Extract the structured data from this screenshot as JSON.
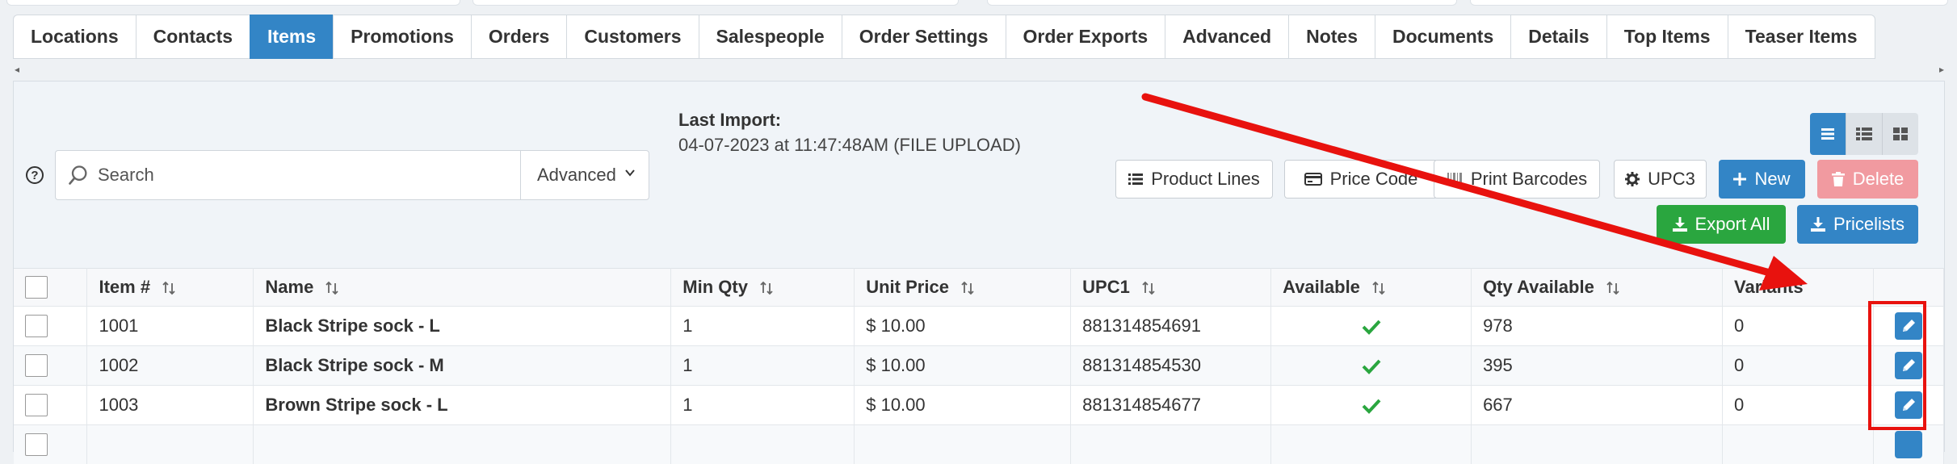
{
  "tabs": [
    {
      "label": "Locations",
      "active": false
    },
    {
      "label": "Contacts",
      "active": false
    },
    {
      "label": "Items",
      "active": true
    },
    {
      "label": "Promotions",
      "active": false
    },
    {
      "label": "Orders",
      "active": false
    },
    {
      "label": "Customers",
      "active": false
    },
    {
      "label": "Salespeople",
      "active": false
    },
    {
      "label": "Order Settings",
      "active": false
    },
    {
      "label": "Order Exports",
      "active": false
    },
    {
      "label": "Advanced",
      "active": false
    },
    {
      "label": "Notes",
      "active": false
    },
    {
      "label": "Documents",
      "active": false
    },
    {
      "label": "Details",
      "active": false
    },
    {
      "label": "Top Items",
      "active": false
    },
    {
      "label": "Teaser Items",
      "active": false
    }
  ],
  "help": {
    "icon": "question-circle-icon",
    "glyph": "?"
  },
  "search": {
    "placeholder": "Search",
    "value": "",
    "icon": "search-icon"
  },
  "advanced_select": {
    "selected": "Advanced"
  },
  "last_import": {
    "label": "Last Import:",
    "value": "04-07-2023 at 11:47:48AM (FILE UPLOAD)"
  },
  "view_toggle": [
    "list-view-icon",
    "detail-list-icon",
    "grid-view-icon"
  ],
  "toolbar": {
    "product_lines": "Product Lines",
    "price_code": "Price Code",
    "print_barcodes": "Print Barcodes",
    "upc3": "UPC3",
    "new": "New",
    "delete": "Delete",
    "export_all": "Export All",
    "pricelists": "Pricelists"
  },
  "table": {
    "columns": [
      "Item #",
      "Name",
      "Min Qty",
      "Unit Price",
      "UPC1",
      "Available",
      "Qty Available",
      "Variants"
    ],
    "rows": [
      {
        "item": "1001",
        "name": "Black Stripe sock - L",
        "min_qty": "1",
        "unit_price": "$ 10.00",
        "upc1": "881314854691",
        "available": true,
        "qty_available": "978",
        "variants": "0"
      },
      {
        "item": "1002",
        "name": "Black Stripe sock - M",
        "min_qty": "1",
        "unit_price": "$ 10.00",
        "upc1": "881314854530",
        "available": true,
        "qty_available": "395",
        "variants": "0"
      },
      {
        "item": "1003",
        "name": "Brown Stripe sock - L",
        "min_qty": "1",
        "unit_price": "$ 10.00",
        "upc1": "881314854677",
        "available": true,
        "qty_available": "667",
        "variants": "0"
      }
    ]
  },
  "colors": {
    "primary": "#3385c6",
    "success": "#2aa63f",
    "danger_disabled": "#f19aa0",
    "annotation": "#e8120e",
    "check": "#2aa63f"
  }
}
